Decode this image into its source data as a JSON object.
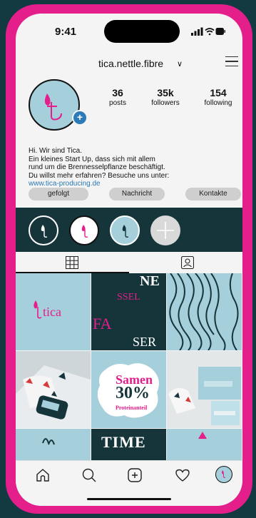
{
  "status": {
    "time": "9:41"
  },
  "profile": {
    "username": "tica.nettle.fibre",
    "chevron": "∨",
    "stats": [
      {
        "number": "36",
        "label": "posts"
      },
      {
        "number": "35k",
        "label": "followers"
      },
      {
        "number": "154",
        "label": "following"
      }
    ],
    "bio": {
      "line1": "Hi. Wir sind Tica.",
      "line2": "Ein kleines Start Up, dass sich mit allem",
      "line3": "rund um die Brennesselpflanze beschäftigt.",
      "line4": "Du willst mehr erfahren? Besuche uns unter:",
      "link": "www.tica-producing.de"
    },
    "buttons": {
      "follow": "gefolgt",
      "message": "Nachricht",
      "contact": "Kontakte"
    }
  },
  "posts": {
    "brand": "tica",
    "poster_words": [
      "NE",
      "SSEL",
      "FA",
      "SER"
    ],
    "promo": {
      "line1": "Samen",
      "line2": "30%",
      "line3": "Proteinanteil"
    },
    "time_word": "TIME"
  },
  "colors": {
    "accent": "#e41f8c",
    "dark": "#15353b",
    "light_blue": "#a5cfdb",
    "link": "#2a78b0"
  },
  "icons": [
    "home-icon",
    "search-icon",
    "add-post-icon",
    "heart-icon",
    "profile-icon",
    "grid-icon",
    "tagged-icon",
    "menu-icon"
  ]
}
